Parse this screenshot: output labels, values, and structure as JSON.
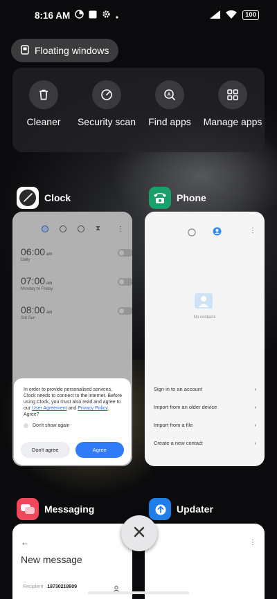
{
  "status_bar": {
    "time": "8:16 AM",
    "battery": "100"
  },
  "floating_windows": {
    "label": "Floating windows"
  },
  "quick_actions": [
    {
      "label": "Cleaner",
      "icon": "trash-icon"
    },
    {
      "label": "Security scan",
      "icon": "shield-scan-icon"
    },
    {
      "label": "Find apps",
      "icon": "app-search-icon"
    },
    {
      "label": "Manage apps",
      "icon": "grid-icon"
    }
  ],
  "apps": {
    "clock": {
      "name": "Clock",
      "alarms": [
        {
          "time": "06:00",
          "ampm": "am",
          "sub": "Daily"
        },
        {
          "time": "07:00",
          "ampm": "am",
          "sub": "Monday to Friday"
        },
        {
          "time": "08:00",
          "ampm": "am",
          "sub": "Sat Sun"
        }
      ],
      "dialog": {
        "text_before": "In order to provide personalised services, Clock needs to connect to the internet. Before using Clock, you must also read and agree to our ",
        "link1": "User Agreement",
        "and": " and ",
        "link2": "Privacy Policy",
        "text_after": ". Agree?",
        "checkbox": "Don't show again",
        "disagree": "Don't agree",
        "agree": "Agree"
      }
    },
    "phone": {
      "name": "Phone",
      "empty": "No contacts",
      "rows": [
        "Sign in to an account",
        "Import from an older device",
        "Import from a file",
        "Create a new contact"
      ]
    },
    "messaging": {
      "name": "Messaging",
      "title": "New message",
      "recipient_label": "Recipient",
      "recipient_value": "18730218809"
    },
    "updater": {
      "name": "Updater"
    }
  },
  "colors": {
    "agree_blue": "#2f7cf6",
    "phone_green": "#1aa06a",
    "messaging_red": "#f0475a",
    "updater_blue": "#1f7ee8"
  }
}
